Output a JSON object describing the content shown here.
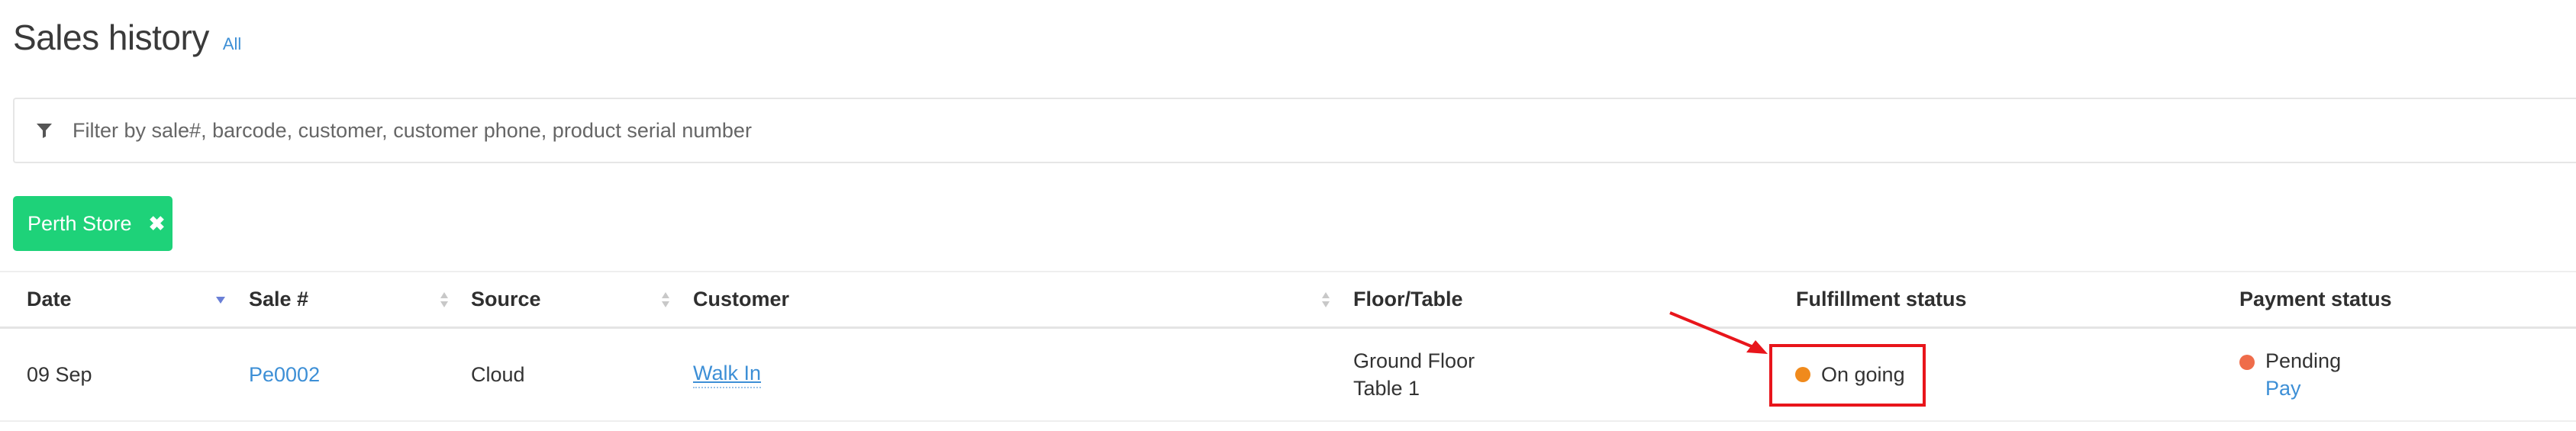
{
  "header": {
    "title": "Sales history",
    "filter_link": "All"
  },
  "search": {
    "placeholder": "Filter by sale#, barcode, customer, customer phone, product serial number",
    "value": ""
  },
  "active_filter": {
    "label": "Perth Store",
    "color": "#1ed279"
  },
  "table": {
    "columns": {
      "date": "Date",
      "sale": "Sale #",
      "source": "Source",
      "customer": "Customer",
      "floor_table": "Floor/Table",
      "fulfillment": "Fulfillment status",
      "payment": "Payment status"
    },
    "sort": {
      "date": "descending",
      "sale": "sortable",
      "source": "sortable",
      "customer": "sortable"
    },
    "rows": [
      {
        "date": "09 Sep",
        "sale_number": "Pe0002",
        "source": "Cloud",
        "customer": "Walk In",
        "floor": "Ground Floor",
        "table": "Table 1",
        "fulfillment_status": "On going",
        "fulfillment_color": "#f08a1c",
        "payment_status": "Pending",
        "payment_color": "#ef6c4a",
        "payment_action": "Pay"
      }
    ]
  },
  "annotation": {
    "highlight_color": "#e8151b"
  }
}
